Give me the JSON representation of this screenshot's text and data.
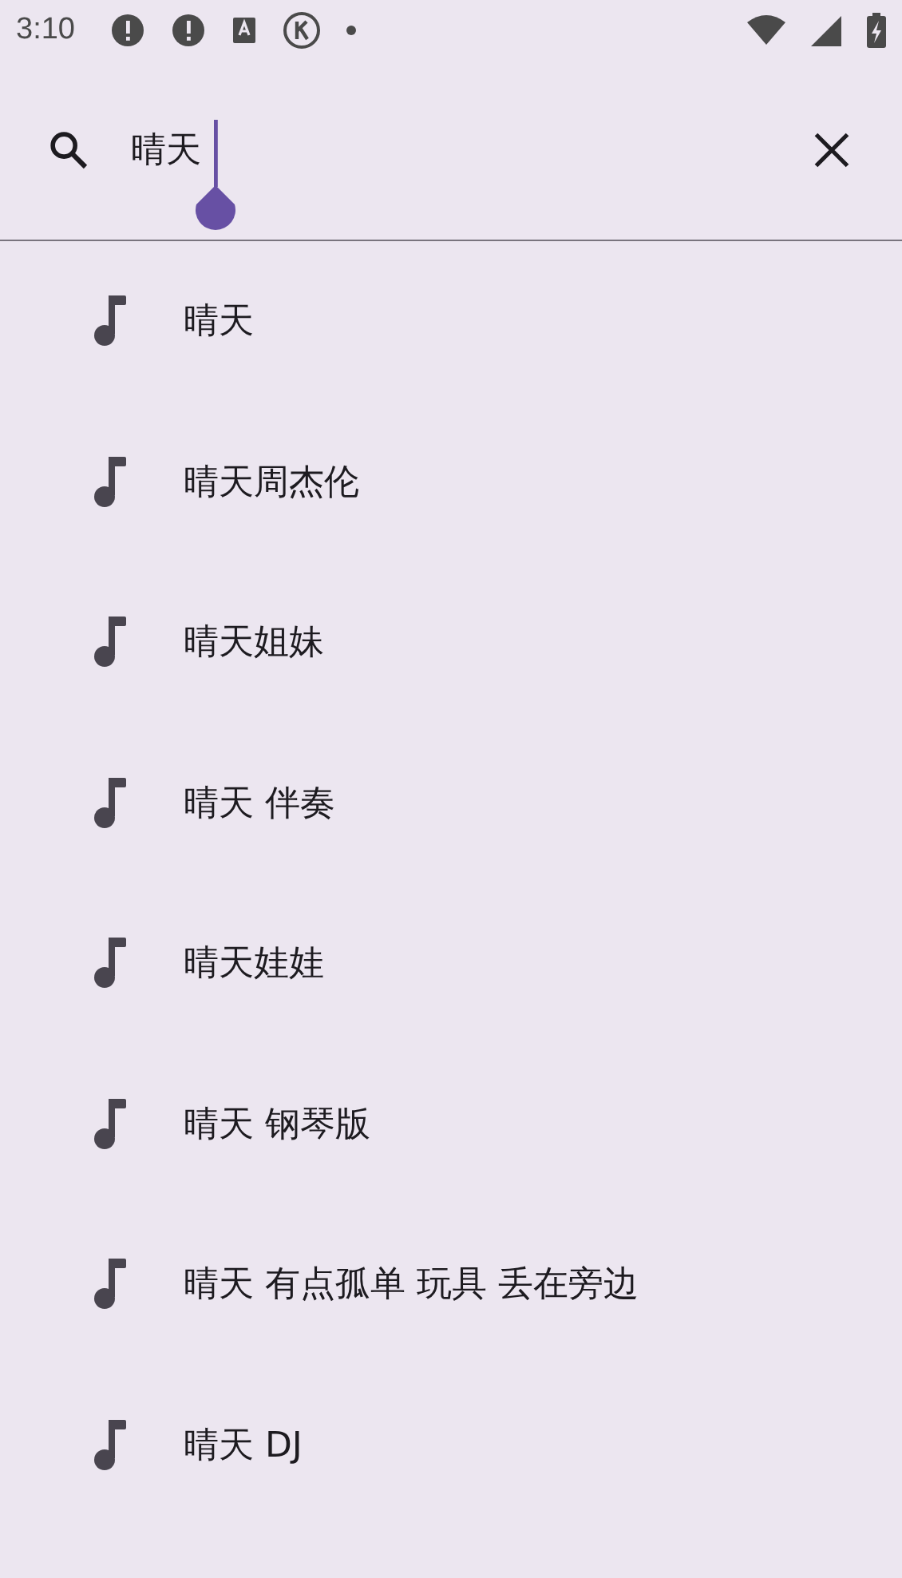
{
  "status_bar": {
    "time": "3:10"
  },
  "search": {
    "value": "晴天"
  },
  "suggestions": [
    {
      "text": "晴天"
    },
    {
      "text": "晴天周杰伦"
    },
    {
      "text": "晴天姐妹"
    },
    {
      "text": "晴天 伴奏"
    },
    {
      "text": "晴天娃娃"
    },
    {
      "text": "晴天 钢琴版"
    },
    {
      "text": "晴天 有点孤单 玩具 丢在旁边"
    },
    {
      "text": "晴天 DJ"
    }
  ]
}
